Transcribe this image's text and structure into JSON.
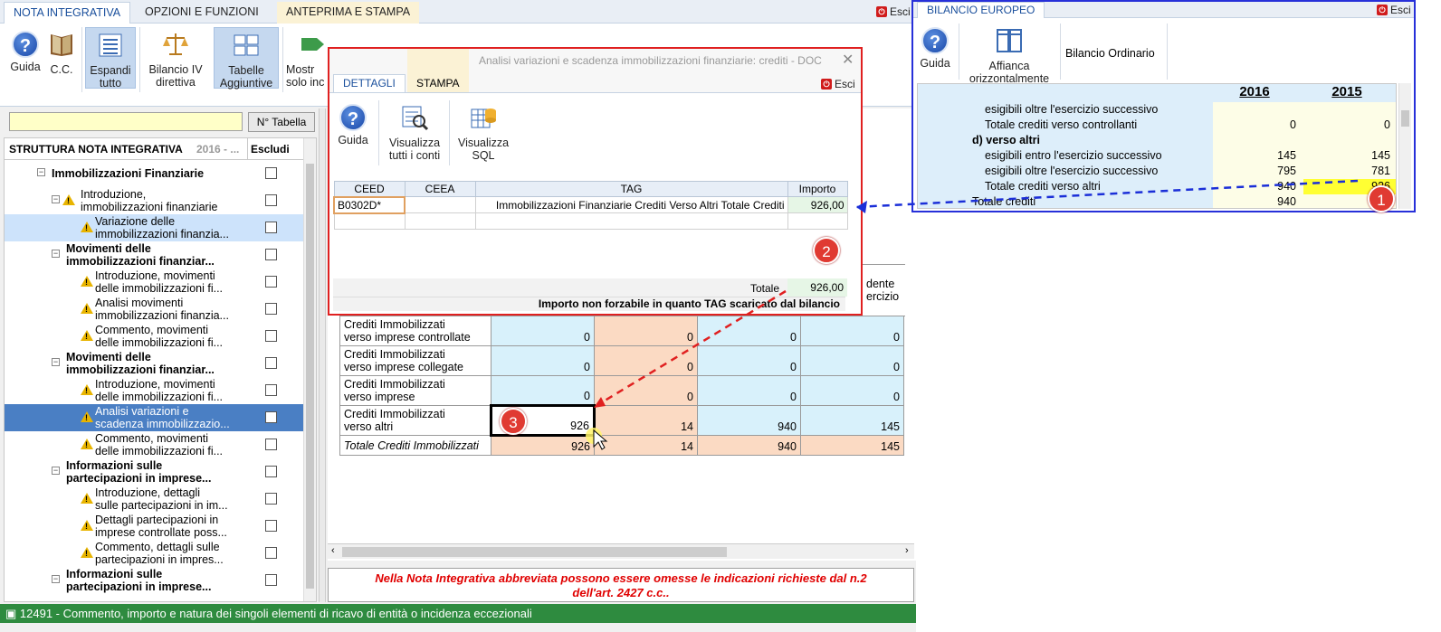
{
  "main": {
    "tabs": [
      "NOTA INTEGRATIVA",
      "OPZIONI E FUNZIONI",
      "ANTEPRIMA E STAMPA"
    ],
    "exit_label": "Esci",
    "ribbon": {
      "guida": "Guida",
      "cc": "C.C.",
      "espandi_1": "Espandi",
      "espandi_2": "tutto",
      "bilancio_1": "Bilancio IV",
      "bilancio_2": "direttiva",
      "tabelle_1": "Tabelle",
      "tabelle_2": "Aggiuntive",
      "mostra_1": "Mostr",
      "mostra_2": "solo inc"
    },
    "search": {
      "placeholder": "",
      "ntab_label": "N° Tabella"
    },
    "tree": {
      "header_title": "STRUTTURA NOTA INTEGRATIVA",
      "header_year": "2016 - ...",
      "header_escludi": "Escludi",
      "rows": [
        {
          "l1": "Immobilizzazioni Finanziarie",
          "l2": ""
        },
        {
          "l1": "Introduzione,",
          "l2": "immobilizzazioni finanziarie"
        },
        {
          "l1": "Variazione delle",
          "l2": "immobilizzazioni finanzia..."
        },
        {
          "l1": "Movimenti delle",
          "l2": "immobilizzazioni finanziar..."
        },
        {
          "l1": "Introduzione, movimenti",
          "l2": "delle immobilizzazioni fi..."
        },
        {
          "l1": "Analisi movimenti",
          "l2": "immobilizzazioni finanzia..."
        },
        {
          "l1": "Commento, movimenti",
          "l2": "delle immobilizzazioni fi..."
        },
        {
          "l1": "Movimenti delle",
          "l2": "immobilizzazioni finanziar..."
        },
        {
          "l1": "Introduzione, movimenti",
          "l2": "delle immobilizzazioni fi..."
        },
        {
          "l1": "Analisi variazioni e",
          "l2": "scadenza immobilizzazio..."
        },
        {
          "l1": "Commento, movimenti",
          "l2": "delle immobilizzazioni fi..."
        },
        {
          "l1": "Informazioni sulle",
          "l2": "partecipazioni  in  imprese..."
        },
        {
          "l1": "Introduzione, dettagli",
          "l2": "sulle partecipazioni in im..."
        },
        {
          "l1": "Dettagli partecipazioni in",
          "l2": "imprese controllate poss..."
        },
        {
          "l1": "Commento, dettagli sulle",
          "l2": "partecipazioni in impres..."
        },
        {
          "l1": "Informazioni sulle",
          "l2": "partecipazioni  in  imprese..."
        }
      ]
    },
    "grid": {
      "header_partial_1": "dente",
      "header_partial_2": "ercizio",
      "rows": [
        {
          "l1": "Crediti Immobilizzati",
          "l2": "verso imprese controllate",
          "v": [
            "0",
            "0",
            "0",
            "0"
          ]
        },
        {
          "l1": "Crediti Immobilizzati",
          "l2": "verso imprese collegate",
          "v": [
            "0",
            "0",
            "0",
            "0"
          ]
        },
        {
          "l1": "Crediti Immobilizzati",
          "l2": "verso imprese",
          "v": [
            "0",
            "0",
            "0",
            "0"
          ]
        },
        {
          "l1": "Crediti Immobilizzati",
          "l2": "verso altri",
          "v": [
            "926",
            "14",
            "940",
            "145"
          ]
        }
      ],
      "total": {
        "label": "Totale Crediti Immobilizzati",
        "v": [
          "926",
          "14",
          "940",
          "145"
        ]
      }
    },
    "note_1": "Nella Nota Integrativa abbreviata possono essere omesse le indicazioni richieste dal n.2",
    "note_2": "dell'art. 2427 c.c..",
    "status": "12491 - Commento, importo e natura dei singoli elementi di ricavo di entità o incidenza eccezionali"
  },
  "popup": {
    "title": "Analisi variazioni e scadenza immobilizzazioni finanziarie: crediti - DOC",
    "tabs": [
      "DETTAGLI",
      "STAMPA"
    ],
    "exit_label": "Esci",
    "ribbon": {
      "guida": "Guida",
      "vis_1": "Visualizza",
      "vis_2": "tutti i conti",
      "sql_1": "Visualizza",
      "sql_2": "SQL"
    },
    "columns": [
      "CEED",
      "CEEA",
      "TAG",
      "Importo"
    ],
    "row": {
      "ceed": "B0302D*",
      "ceea": "",
      "tag": "Immobilizzazioni Finanziarie Crediti Verso Altri Totale Crediti",
      "importo": "926,00"
    },
    "total_label": "Totale",
    "total_value": "926,00",
    "note": "Importo non forzabile in quanto TAG scaricato dal bilancio"
  },
  "side": {
    "tab": "BILANCIO EUROPEO",
    "exit_label": "Esci",
    "ribbon": {
      "guida": "Guida",
      "affianca_1": "Affianca",
      "affianca_2": "orizzontalmente",
      "ordinario": "Bilancio Ordinario"
    },
    "header": {
      "y1": "2016",
      "y2": "2015"
    },
    "rows": [
      {
        "label": "esigibili oltre l'esercizio successivo",
        "v1": "",
        "v2": ""
      },
      {
        "label": "Totale crediti verso controllanti",
        "v1": "0",
        "v2": "0"
      },
      {
        "label": "d) verso altri",
        "v1": "",
        "v2": ""
      },
      {
        "label": "esigibili entro l'esercizio successivo",
        "v1": "145",
        "v2": "145"
      },
      {
        "label": "esigibili oltre l'esercizio successivo",
        "v1": "795",
        "v2": "781"
      },
      {
        "label": "Totale crediti verso altri",
        "v1": "940",
        "v2": "926"
      },
      {
        "label": "Totale crediti",
        "v1": "940",
        "v2": ""
      }
    ]
  },
  "markers": [
    "1",
    "2",
    "3"
  ]
}
